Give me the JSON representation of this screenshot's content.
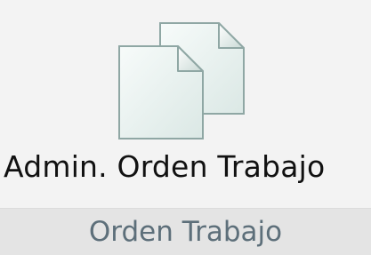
{
  "ribbon": {
    "button": {
      "label": "Admin. Orden Trabajo",
      "icon": "documents-icon"
    },
    "group": {
      "label": "Orden Trabajo"
    }
  }
}
